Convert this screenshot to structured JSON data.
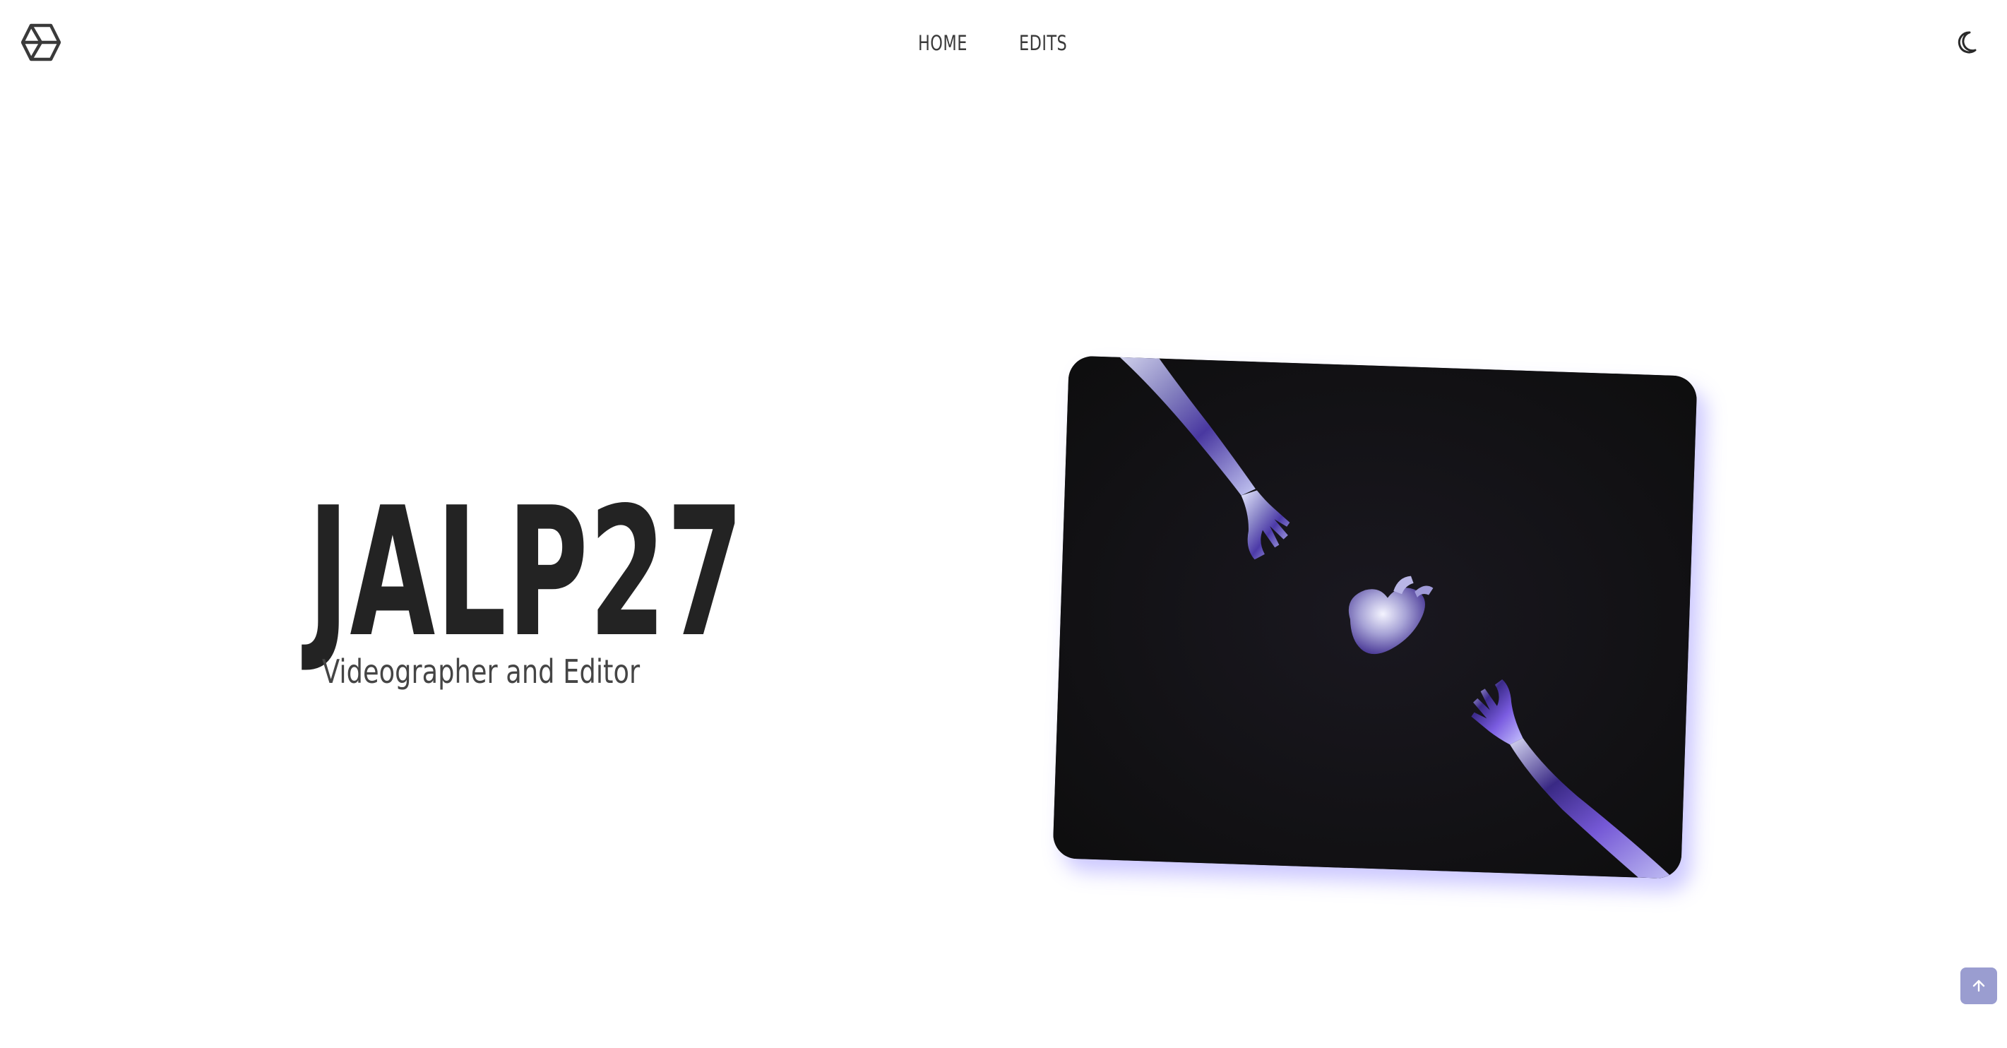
{
  "header": {
    "logo_icon": "hexagon-cube-icon",
    "nav": [
      {
        "label": "HOME"
      },
      {
        "label": "EDITS"
      }
    ],
    "theme_toggle_icon": "moon-icon"
  },
  "hero": {
    "title": "JALP27",
    "subtitle": "Videographer and Editor",
    "image_icon": "chrome-hands-heart-artwork"
  },
  "scroll_top": {
    "icon": "arrow-up-icon"
  },
  "colors": {
    "accent_shadow": "#7a6eff",
    "scroll_button": "#9a9dd0",
    "text": "#232323"
  }
}
